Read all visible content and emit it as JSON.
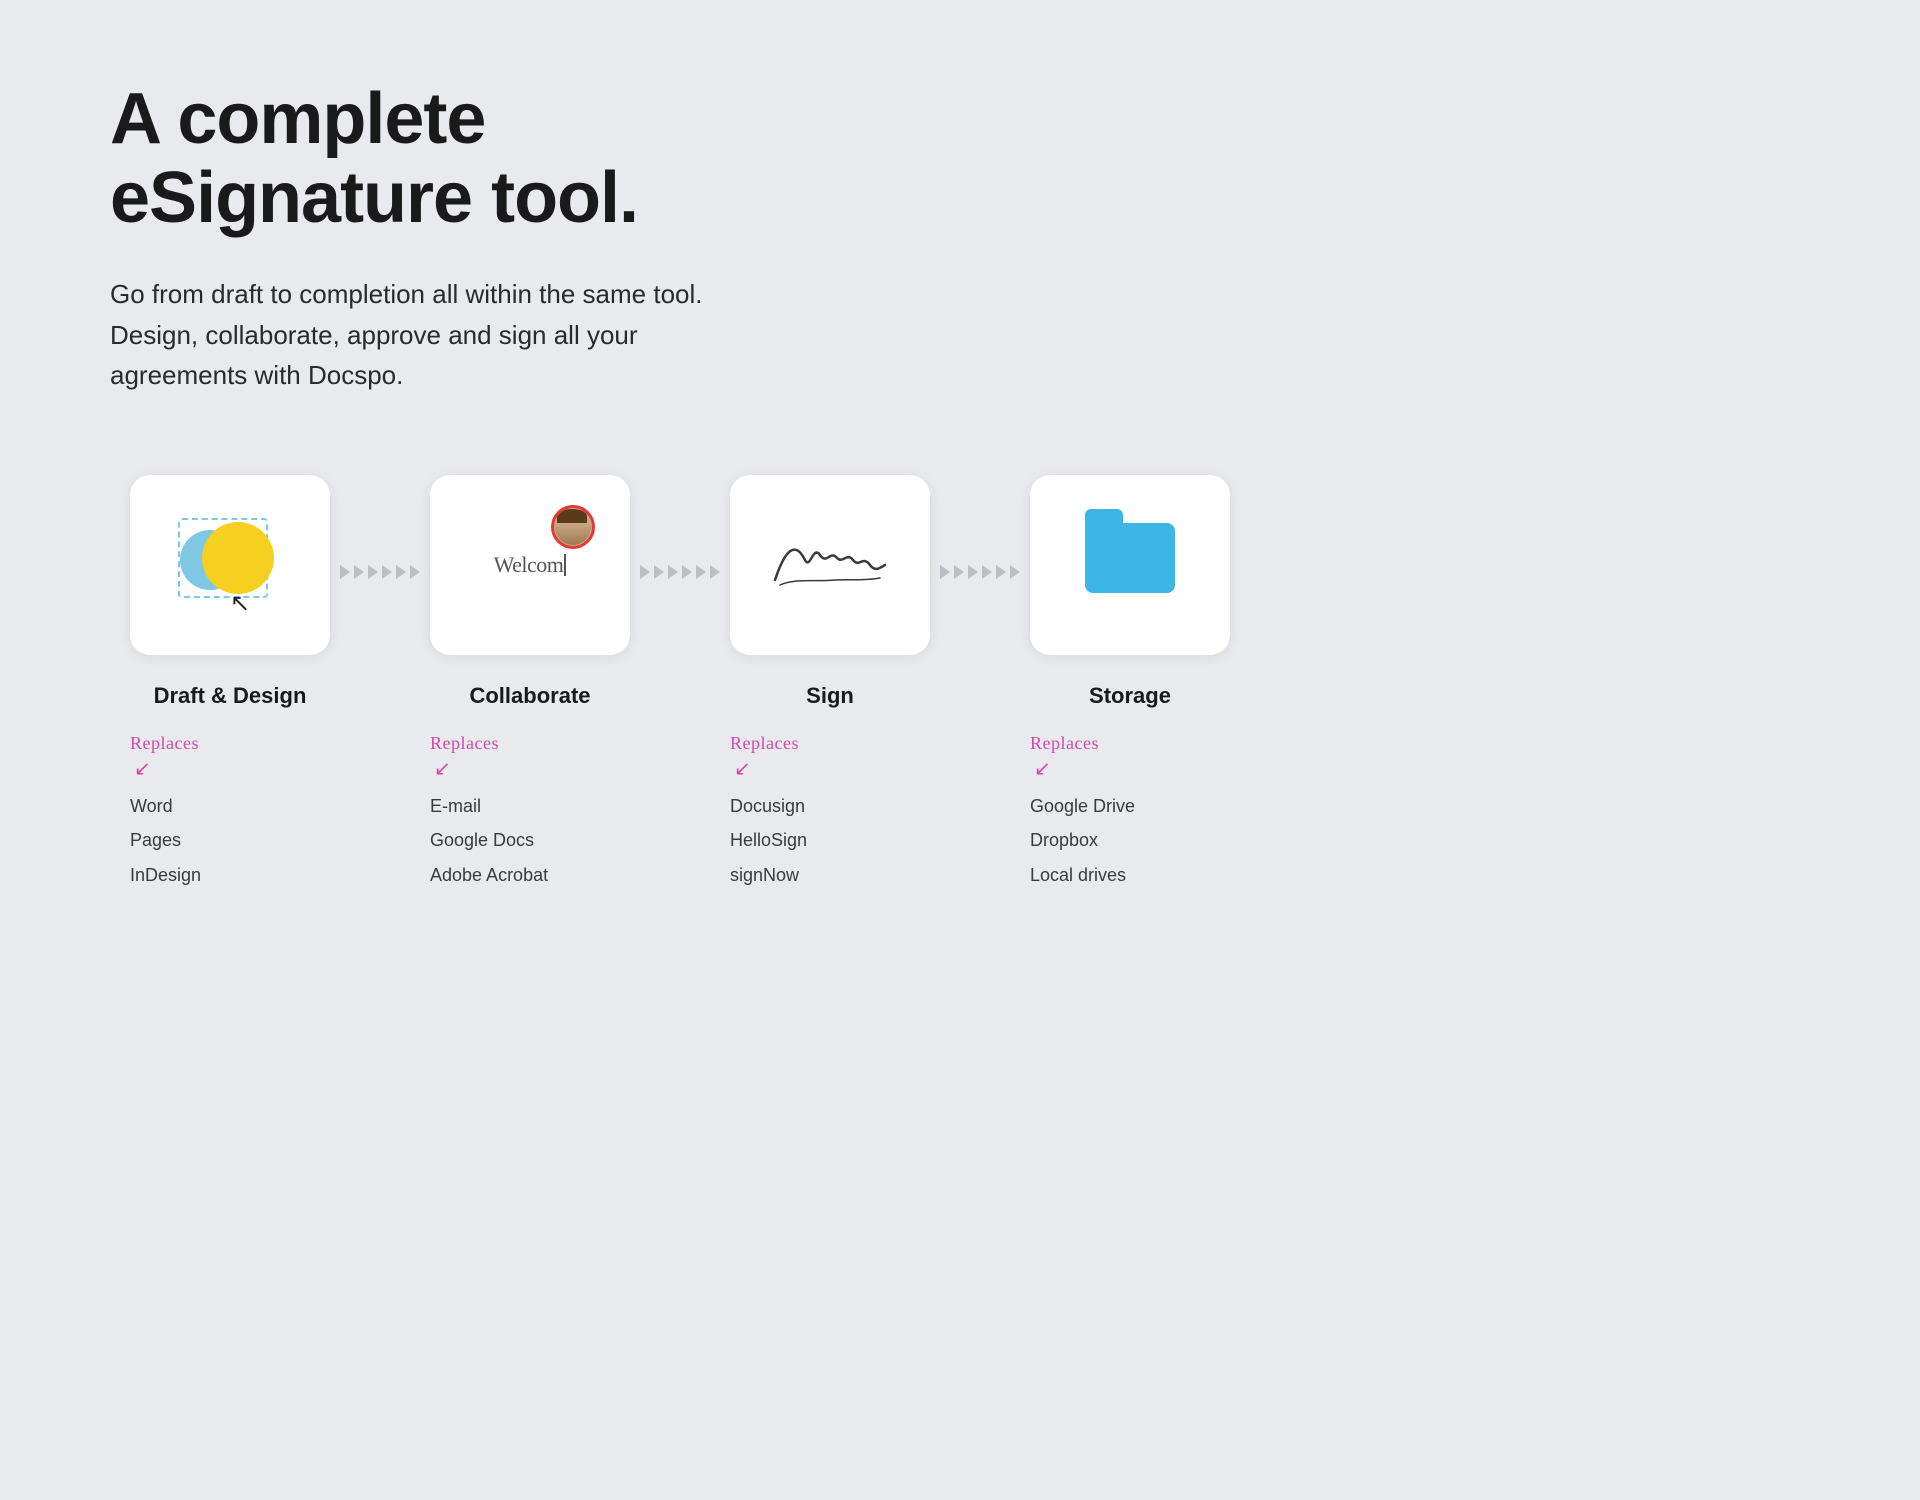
{
  "page": {
    "background": "#e8eaed"
  },
  "headline": {
    "line1": "A complete",
    "line2": "eSignature tool."
  },
  "subtitle": "Go from draft to completion all within the same tool. Design, collaborate, approve and sign all your agreements with Docspo.",
  "steps": [
    {
      "id": "draft-design",
      "title": "Draft & Design",
      "replaces_label": "Replaces",
      "replaces_items": [
        "Word",
        "Pages",
        "InDesign"
      ]
    },
    {
      "id": "collaborate",
      "title": "Collaborate",
      "replaces_label": "Replaces",
      "replaces_items": [
        "E-mail",
        "Google Docs",
        "Adobe Acrobat"
      ]
    },
    {
      "id": "sign",
      "title": "Sign",
      "replaces_label": "Replaces",
      "replaces_items": [
        "Docusign",
        "HelloSign",
        "signNow"
      ]
    },
    {
      "id": "storage",
      "title": "Storage",
      "replaces_label": "Replaces",
      "replaces_items": [
        "Google Drive",
        "Dropbox",
        "Local drives"
      ]
    }
  ],
  "arrows": {
    "count": 6
  }
}
